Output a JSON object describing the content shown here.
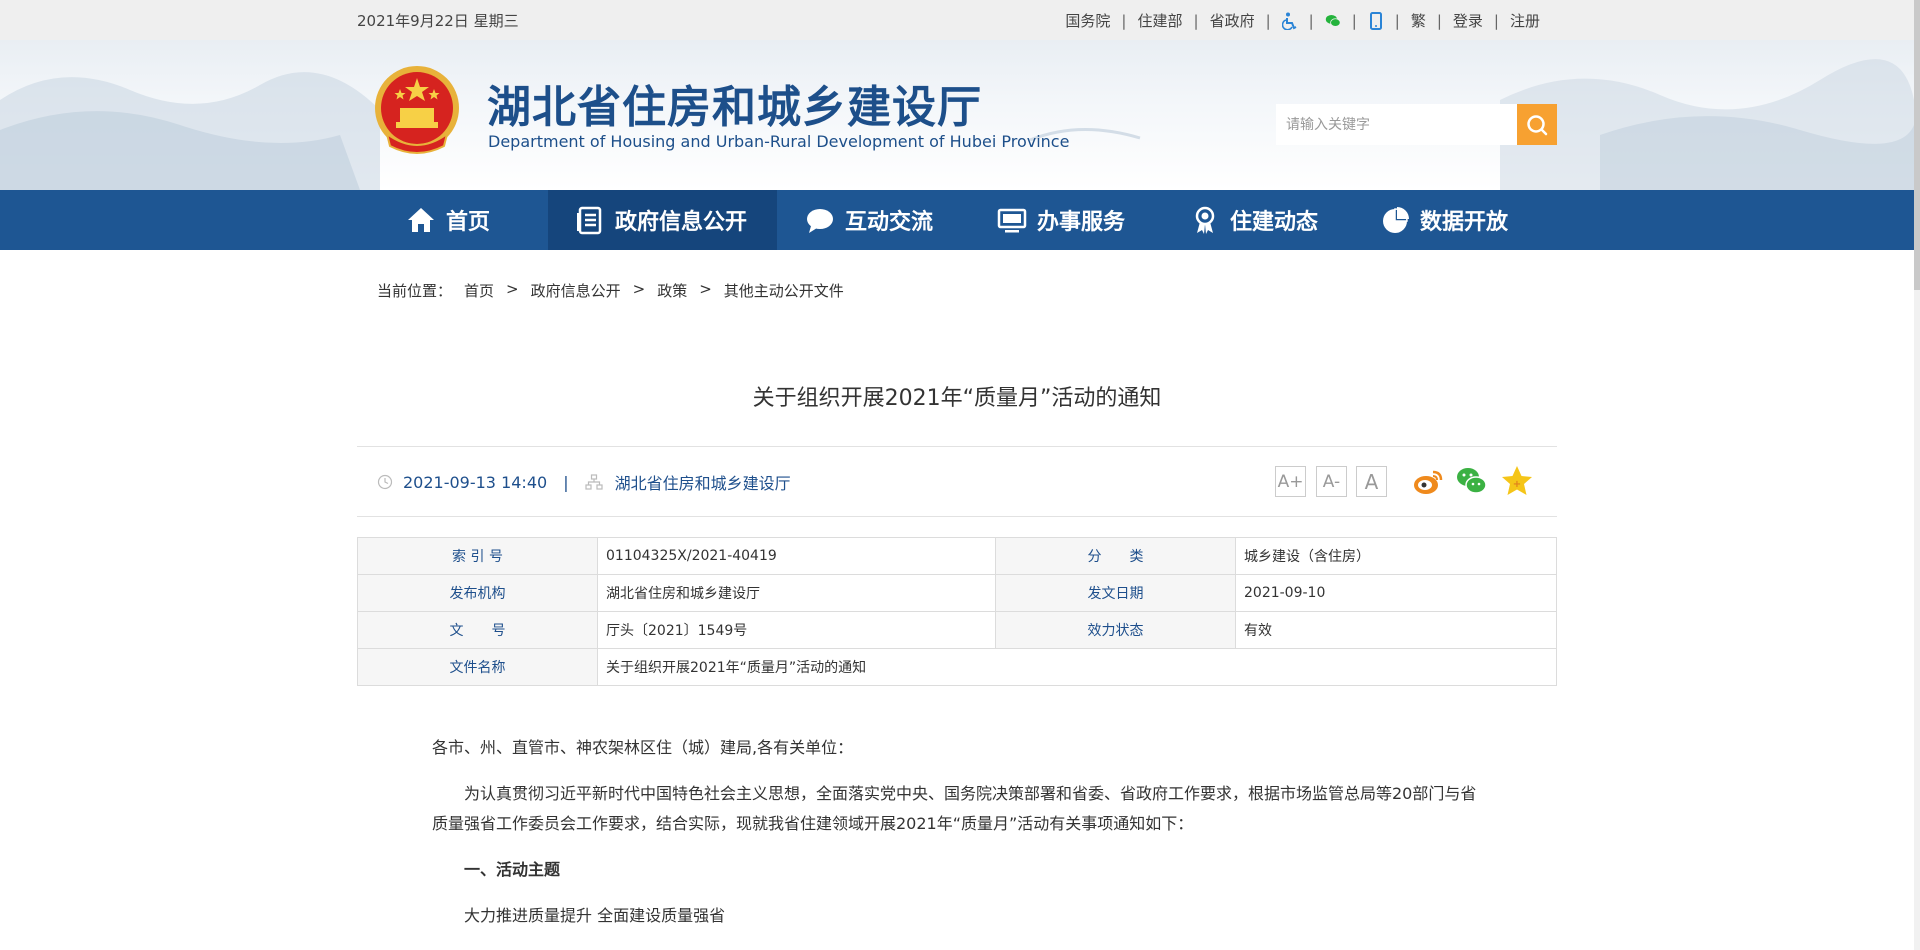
{
  "topbar": {
    "date": "2021年9月22日 星期三",
    "links": [
      "国务院",
      "住建部",
      "省政府"
    ],
    "icons": [
      "accessibility-icon",
      "wechat-icon",
      "mobile-icon"
    ],
    "lang": "繁",
    "login": "登录",
    "register": "注册"
  },
  "header": {
    "title": "湖北省住房和城乡建设厅",
    "subtitle": "Department of Housing and Urban-Rural Development of Hubei Province",
    "search_placeholder": "请输入关键字",
    "accent": "#f7a131"
  },
  "nav": {
    "items": [
      {
        "label": "首页",
        "icon": "home-icon"
      },
      {
        "label": "政府信息公开",
        "icon": "document-list-icon",
        "active": true
      },
      {
        "label": "互动交流",
        "icon": "chat-bubble-icon"
      },
      {
        "label": "办事服务",
        "icon": "monitor-icon"
      },
      {
        "label": "住建动态",
        "icon": "award-ribbon-icon"
      },
      {
        "label": "数据开放",
        "icon": "pie-chart-icon"
      }
    ],
    "color": "#1e5693"
  },
  "breadcrumb": {
    "prefix": "当前位置：",
    "items": [
      "首页",
      "政府信息公开",
      "政策",
      "其他主动公开文件"
    ],
    "sep": ">"
  },
  "article": {
    "title": "关于组织开展2021年“质量月”活动的通知",
    "datetime": "2021-09-13 14:40",
    "divider": "|",
    "source": "湖北省住房和城乡建设厅",
    "font_buttons": [
      "A+",
      "A-",
      "A"
    ],
    "share_icons": [
      "weibo-icon",
      "wechat-share-icon",
      "favorite-star-icon"
    ]
  },
  "info_table": {
    "index_label": "索 引 号",
    "index_value": "01104325X/2021-40419",
    "category_label": "分　　类",
    "category_value": "城乡建设（含住房）",
    "publisher_label": "发布机构",
    "publisher_value": "湖北省住房和城乡建设厅",
    "issue_date_label": "发文日期",
    "issue_date_value": "2021-09-10",
    "doc_no_label": "文　　号",
    "doc_no_value": "厅头〔2021〕1549号",
    "status_label": "效力状态",
    "status_value": "有效",
    "name_label": "文件名称",
    "name_value": "关于组织开展2021年“质量月”活动的通知"
  },
  "body": {
    "salutation": "各市、州、直管市、神农架林区住（城）建局,各有关单位：",
    "para1": "为认真贯彻习近平新时代中国特色社会主义思想，全面落实党中央、国务院决策部署和省委、省政府工作要求，根据市场监管总局等20部门与省质量强省工作委员会工作要求，结合实际，现就我省住建领域开展2021年“质量月”活动有关事项通知如下：",
    "heading1": "一、活动主题",
    "theme": "大力推进质量提升 全面建设质量强省"
  }
}
